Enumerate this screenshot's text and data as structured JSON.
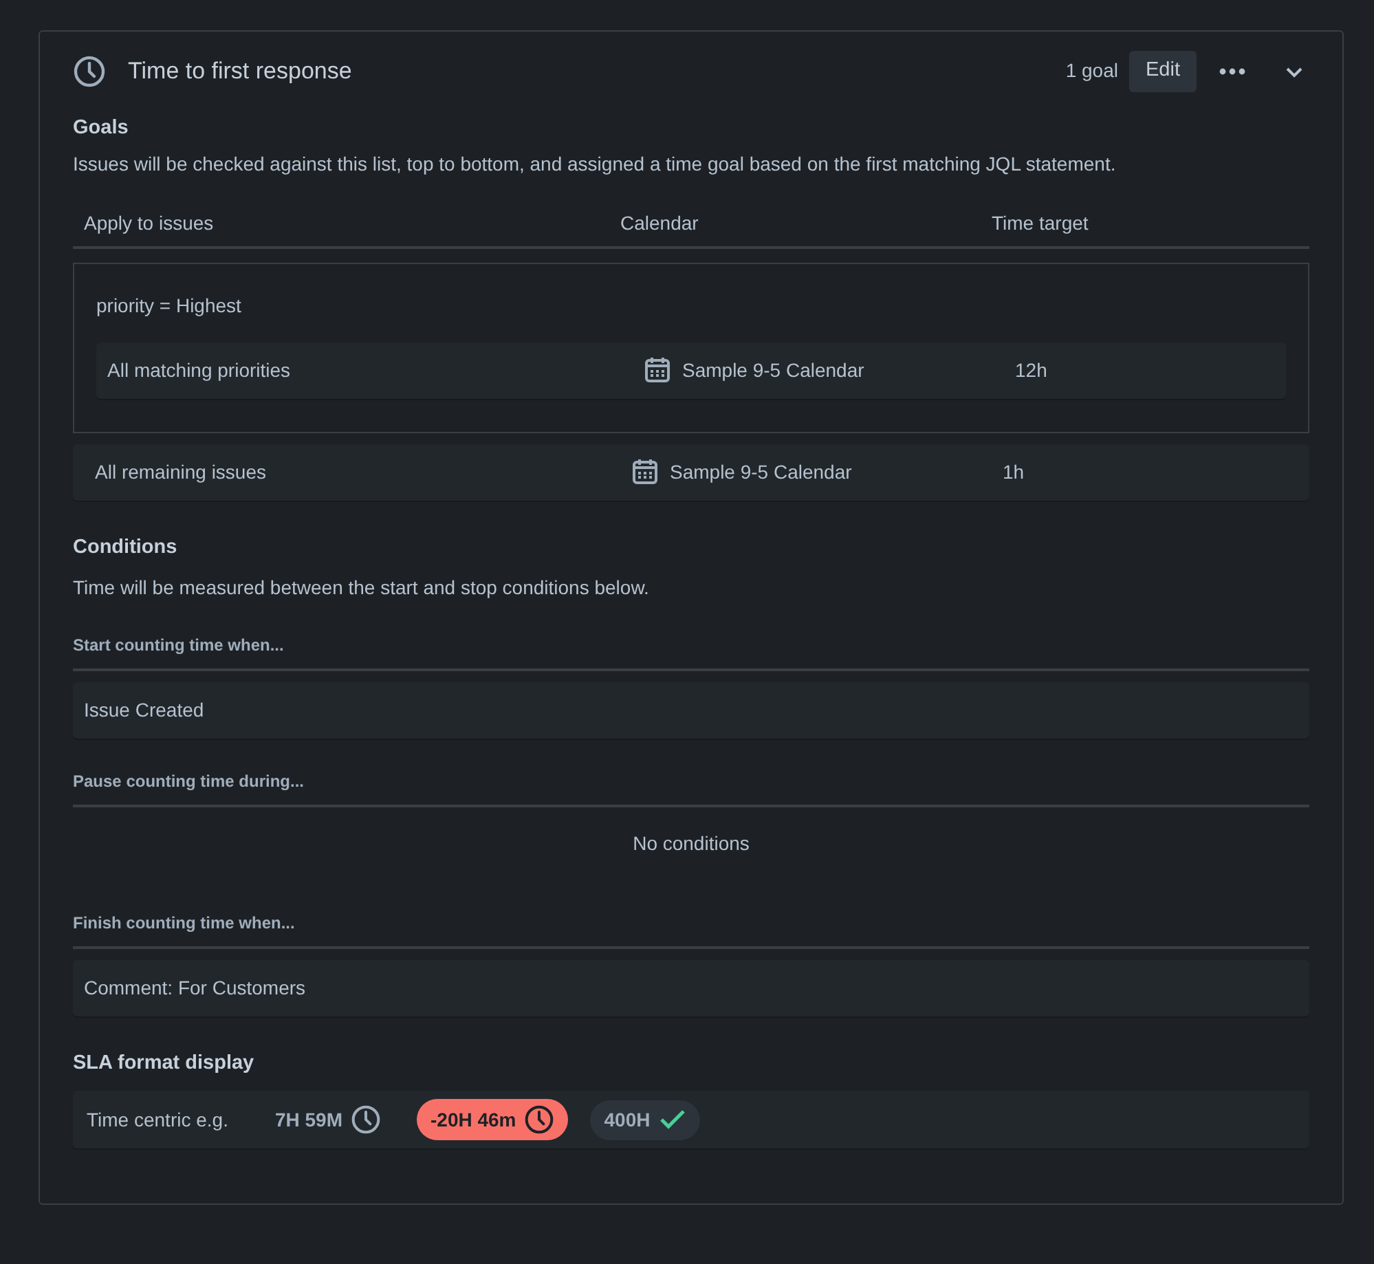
{
  "panel": {
    "title": "Time to first response",
    "goal_count": "1 goal",
    "edit_button": "Edit",
    "expanded": true
  },
  "goals": {
    "heading": "Goals",
    "description": "Issues will be checked against this list, top to bottom, and assigned a time goal based on the first matching JQL statement.",
    "columns": [
      "Apply to issues",
      "Calendar",
      "Time target"
    ],
    "groups": [
      {
        "kind": "jql",
        "query": "priority = Highest",
        "rows": [
          {
            "issues": "All matching priorities",
            "calendar": "Sample 9-5 Calendar",
            "target": "12h"
          }
        ]
      },
      {
        "kind": "plain",
        "rows": [
          {
            "issues": "All remaining issues",
            "calendar": "Sample 9-5 Calendar",
            "target": "1h"
          }
        ]
      }
    ]
  },
  "conditions": {
    "heading": "Conditions",
    "description": "Time will be measured between the start and stop conditions below.",
    "sections": [
      {
        "label": "Start counting time when...",
        "items": [
          "Issue Created"
        ]
      },
      {
        "label": "Pause counting time during...",
        "empty_text": "No conditions"
      },
      {
        "label": "Finish counting time when...",
        "items": [
          "Comment: For Customers"
        ]
      }
    ]
  },
  "sla_format": {
    "heading": "SLA format display",
    "label": "Time centric e.g.",
    "examples": [
      {
        "kind": "running",
        "text": "7H 59M"
      },
      {
        "kind": "breached",
        "text": "-20H 46m"
      },
      {
        "kind": "met",
        "text": "400H"
      }
    ]
  }
}
